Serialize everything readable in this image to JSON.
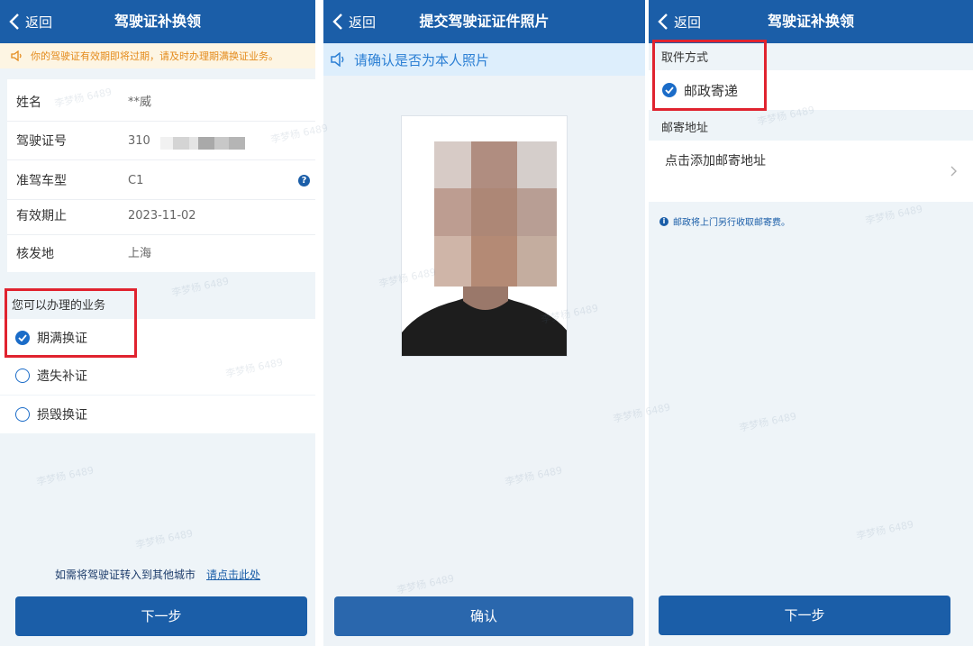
{
  "screens": [
    {
      "nav": {
        "back_label": "返回",
        "title": "驾驶证补换领"
      },
      "notice": "你的驾驶证有效期即将过期，请及时办理期满换证业务。",
      "info_rows": [
        {
          "label": "姓名",
          "value": "**威"
        },
        {
          "label": "驾驶证号",
          "value": "310"
        },
        {
          "label": "准驾车型",
          "value": "C1"
        },
        {
          "label": "有效期止",
          "value": "2023-11-02"
        },
        {
          "label": "核发地",
          "value": "上海"
        }
      ],
      "services_heading": "您可以办理的业务",
      "services": [
        {
          "label": "期满换证",
          "checked": true
        },
        {
          "label": "遗失补证",
          "checked": false
        },
        {
          "label": "损毁换证",
          "checked": false
        }
      ],
      "transfer_text": "如需将驾驶证转入到其他城市",
      "transfer_link": "请点击此处",
      "next_button": "下一步"
    },
    {
      "nav": {
        "back_label": "返回",
        "title": "提交驾驶证证件照片"
      },
      "notice": "请确认是否为本人照片",
      "confirm_button": "确认"
    },
    {
      "nav": {
        "back_label": "返回",
        "title": "驾驶证补换领"
      },
      "pickup_heading": "取件方式",
      "pickup_option": {
        "label": "邮政寄递",
        "checked": true
      },
      "address_heading": "邮寄地址",
      "address_placeholder": "点击添加邮寄地址",
      "postal_tip": "邮政将上门另行收取邮寄费。",
      "next_button": "下一步"
    }
  ],
  "watermark_text": "李梦杨 6489",
  "colors": {
    "brand": "#1b5ea8",
    "highlight": "#e0232f",
    "warning": "#e48b1c",
    "link": "#2b7fd4"
  }
}
